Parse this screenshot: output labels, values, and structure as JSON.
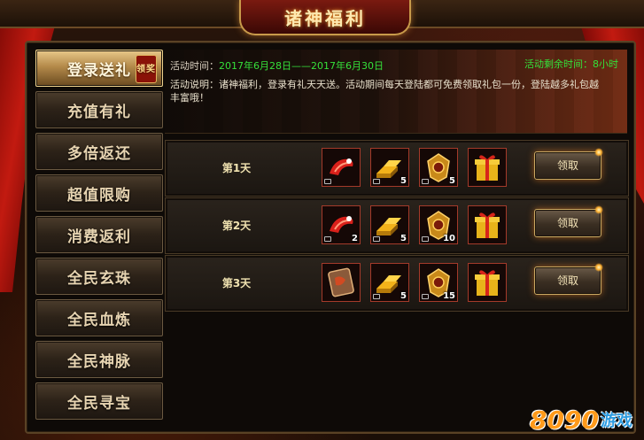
{
  "window": {
    "title": "诸神福利"
  },
  "sidebar": {
    "items": [
      {
        "label": "登录送礼",
        "active": true,
        "badge": "领奖"
      },
      {
        "label": "充值有礼"
      },
      {
        "label": "多倍返还"
      },
      {
        "label": "超值限购"
      },
      {
        "label": "消费返利"
      },
      {
        "label": "全民玄珠"
      },
      {
        "label": "全民血炼"
      },
      {
        "label": "全民神脉"
      },
      {
        "label": "全民寻宝"
      }
    ]
  },
  "info": {
    "time_label": "活动时间：",
    "time_value": "2017年6月28日——2017年6月30日",
    "remaining": "活动剩余时间：8小时",
    "desc": "活动说明：诸神福利，登录有礼天天送。活动期间每天登陆都可免费领取礼包一份，登陆越多礼包越丰富哦！"
  },
  "rows": [
    {
      "day": "第1天",
      "items": [
        {
          "icon": "red-cloak-icon",
          "qty": ""
        },
        {
          "icon": "gold-bars-icon",
          "qty": "5"
        },
        {
          "icon": "medal-icon",
          "qty": "5"
        },
        {
          "icon": "gift-box-icon",
          "qty": ""
        }
      ],
      "button": "领取"
    },
    {
      "day": "第2天",
      "items": [
        {
          "icon": "red-cloak-icon",
          "qty": "2"
        },
        {
          "icon": "gold-bars-icon",
          "qty": "5"
        },
        {
          "icon": "medal-icon",
          "qty": "10"
        },
        {
          "icon": "gift-box-icon",
          "qty": ""
        }
      ],
      "button": "领取"
    },
    {
      "day": "第3天",
      "items": [
        {
          "icon": "scroll-icon",
          "qty": ""
        },
        {
          "icon": "gold-bars-icon",
          "qty": "5"
        },
        {
          "icon": "medal-icon",
          "qty": "15"
        },
        {
          "icon": "gift-box-icon",
          "qty": ""
        }
      ],
      "button": "领取"
    }
  ],
  "watermark": {
    "num": "8090",
    "text": "游戏"
  }
}
